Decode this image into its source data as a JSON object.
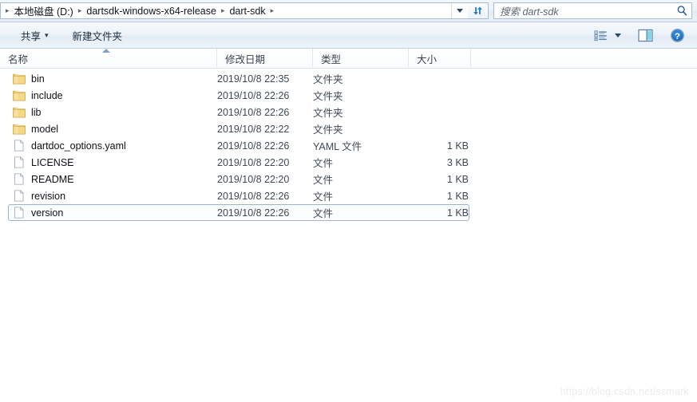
{
  "address": {
    "leading_arrow": "▸",
    "separator": "▸",
    "breadcrumbs": [
      {
        "label": "本地磁盘 (D:)"
      },
      {
        "label": "dartsdk-windows-x64-release"
      },
      {
        "label": "dart-sdk"
      }
    ],
    "dropdown_icon": "chevron-down-icon",
    "refresh_icon": "refresh-icon"
  },
  "search": {
    "placeholder": "搜索 dart-sdk",
    "icon": "search-icon"
  },
  "toolbar": {
    "share_label": "共享",
    "share_caret": "▾",
    "new_folder_label": "新建文件夹",
    "view_icon": "view-list-icon",
    "view_caret_icon": "chevron-down-icon",
    "preview_pane_icon": "preview-pane-icon",
    "help_icon": "help-icon"
  },
  "columns": [
    {
      "key": "name",
      "label": "名称",
      "sorted": "asc"
    },
    {
      "key": "date",
      "label": "修改日期"
    },
    {
      "key": "type",
      "label": "类型"
    },
    {
      "key": "size",
      "label": "大小"
    }
  ],
  "files": [
    {
      "name": "bin",
      "date": "2019/10/8 22:35",
      "type": "文件夹",
      "size": "",
      "icon": "folder-icon",
      "selected": false
    },
    {
      "name": "include",
      "date": "2019/10/8 22:26",
      "type": "文件夹",
      "size": "",
      "icon": "folder-icon",
      "selected": false
    },
    {
      "name": "lib",
      "date": "2019/10/8 22:26",
      "type": "文件夹",
      "size": "",
      "icon": "folder-icon",
      "selected": false
    },
    {
      "name": "model",
      "date": "2019/10/8 22:22",
      "type": "文件夹",
      "size": "",
      "icon": "folder-icon",
      "selected": false
    },
    {
      "name": "dartdoc_options.yaml",
      "date": "2019/10/8 22:26",
      "type": "YAML 文件",
      "size": "1 KB",
      "icon": "file-icon",
      "selected": false
    },
    {
      "name": "LICENSE",
      "date": "2019/10/8 22:20",
      "type": "文件",
      "size": "3 KB",
      "icon": "file-icon",
      "selected": false
    },
    {
      "name": "README",
      "date": "2019/10/8 22:20",
      "type": "文件",
      "size": "1 KB",
      "icon": "file-icon",
      "selected": false
    },
    {
      "name": "revision",
      "date": "2019/10/8 22:26",
      "type": "文件",
      "size": "1 KB",
      "icon": "file-icon",
      "selected": false
    },
    {
      "name": "version",
      "date": "2019/10/8 22:26",
      "type": "文件",
      "size": "1 KB",
      "icon": "file-icon",
      "selected": true
    }
  ],
  "watermark": {
    "text": "https://blog.csdn.net/ssmark"
  },
  "colors": {
    "accent": "#2b6cb0",
    "folder": "#e8c05a",
    "selection_border": "#9cb4cc",
    "chrome": "#eaf1f8"
  }
}
